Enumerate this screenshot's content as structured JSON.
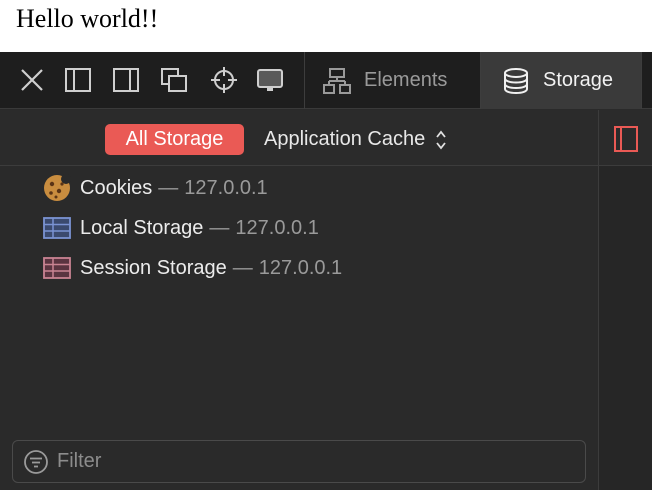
{
  "page": {
    "heading": "Hello world!!"
  },
  "toolbar": {
    "icons": [
      "close-icon",
      "dock-left-icon",
      "dock-right-icon",
      "detach-window-icon",
      "element-picker-icon",
      "device-settings-icon"
    ]
  },
  "tabs": [
    {
      "label": "Elements",
      "icon": "elements-icon",
      "active": false
    },
    {
      "label": "Storage",
      "icon": "storage-icon",
      "active": true
    }
  ],
  "scope": {
    "all_label": "All Storage",
    "select_label": "Application Cache",
    "select_icon": "updown-chevron-icon"
  },
  "tree": {
    "items": [
      {
        "name": "Cookies",
        "dash": "—",
        "host": "127.0.0.1",
        "icon": "cookie-icon"
      },
      {
        "name": "Local Storage",
        "dash": "—",
        "host": "127.0.0.1",
        "icon": "local-storage-icon"
      },
      {
        "name": "Session Storage",
        "dash": "—",
        "host": "127.0.0.1",
        "icon": "session-storage-icon"
      }
    ]
  },
  "filter": {
    "placeholder": "Filter",
    "value": ""
  },
  "colors": {
    "accent": "#ea5a55",
    "panel": "#2a2a2a",
    "tabbar": "#1e1e1e",
    "active_tab": "#3a3a3a"
  }
}
